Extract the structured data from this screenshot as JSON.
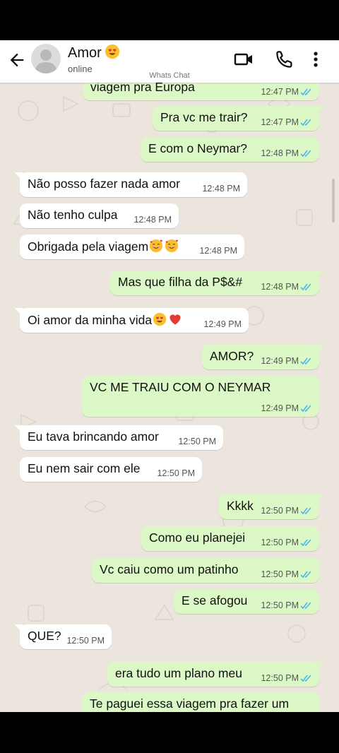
{
  "header": {
    "contact_name": "Amor",
    "contact_status": "online",
    "name_emoji_icon": "heart-eyes-emoji",
    "back_icon": "arrow-left-icon",
    "video_icon": "video-camera-icon",
    "call_icon": "phone-icon",
    "menu_icon": "more-vertical-icon"
  },
  "watermark": "Whats Chat",
  "colors": {
    "outgoing_bubble": "#dcf8c6",
    "incoming_bubble": "#ffffff",
    "chat_background": "#ece5dd",
    "read_ticks": "#4fb6ec"
  },
  "messages": [
    {
      "dir": "out",
      "text": "viagem pra Europa",
      "time": "12:47 PM",
      "read": true
    },
    {
      "dir": "out",
      "text": "Pra vc me trair?",
      "time": "12:47 PM",
      "read": true
    },
    {
      "dir": "out",
      "text": "E com o Neymar?",
      "time": "12:48 PM",
      "read": true
    },
    {
      "dir": "in",
      "text": "Não posso fazer nada amor",
      "time": "12:48 PM"
    },
    {
      "dir": "in",
      "text": "Não tenho culpa",
      "time": "12:48 PM"
    },
    {
      "dir": "in",
      "text": "Obrigada pela viagem",
      "emoji": [
        "smiling-hearts-emoji",
        "smiling-hearts-emoji"
      ],
      "time": "12:48 PM"
    },
    {
      "dir": "out",
      "text": "Mas que filha da P$&#",
      "time": "12:48 PM",
      "read": true
    },
    {
      "dir": "in",
      "text": "Oi amor da minha vida",
      "emoji": [
        "heart-eyes-emoji",
        "red-heart-emoji"
      ],
      "time": "12:49 PM"
    },
    {
      "dir": "out",
      "text": "AMOR?",
      "time": "12:49 PM",
      "read": true
    },
    {
      "dir": "out",
      "text": "VC ME TRAIU COM O NEYMAR",
      "time": "12:49 PM",
      "read": true
    },
    {
      "dir": "in",
      "text": "Eu tava brincando amor",
      "time": "12:50 PM"
    },
    {
      "dir": "in",
      "text": "Eu nem sair com ele",
      "time": "12:50 PM"
    },
    {
      "dir": "out",
      "text": "Kkkk",
      "time": "12:50 PM",
      "read": true
    },
    {
      "dir": "out",
      "text": "Como eu planejei",
      "time": "12:50 PM",
      "read": true
    },
    {
      "dir": "out",
      "text": "Vc caiu como um patinho",
      "time": "12:50 PM",
      "read": true
    },
    {
      "dir": "out",
      "text": "E se afogou",
      "time": "12:50 PM",
      "read": true
    },
    {
      "dir": "in",
      "text": "QUE?",
      "time": "12:50 PM"
    },
    {
      "dir": "out",
      "text": "era tudo um plano meu",
      "time": "12:50 PM",
      "read": true
    },
    {
      "dir": "out",
      "text": "Te paguei essa viagem pra fazer um",
      "time": "",
      "read": false
    }
  ]
}
